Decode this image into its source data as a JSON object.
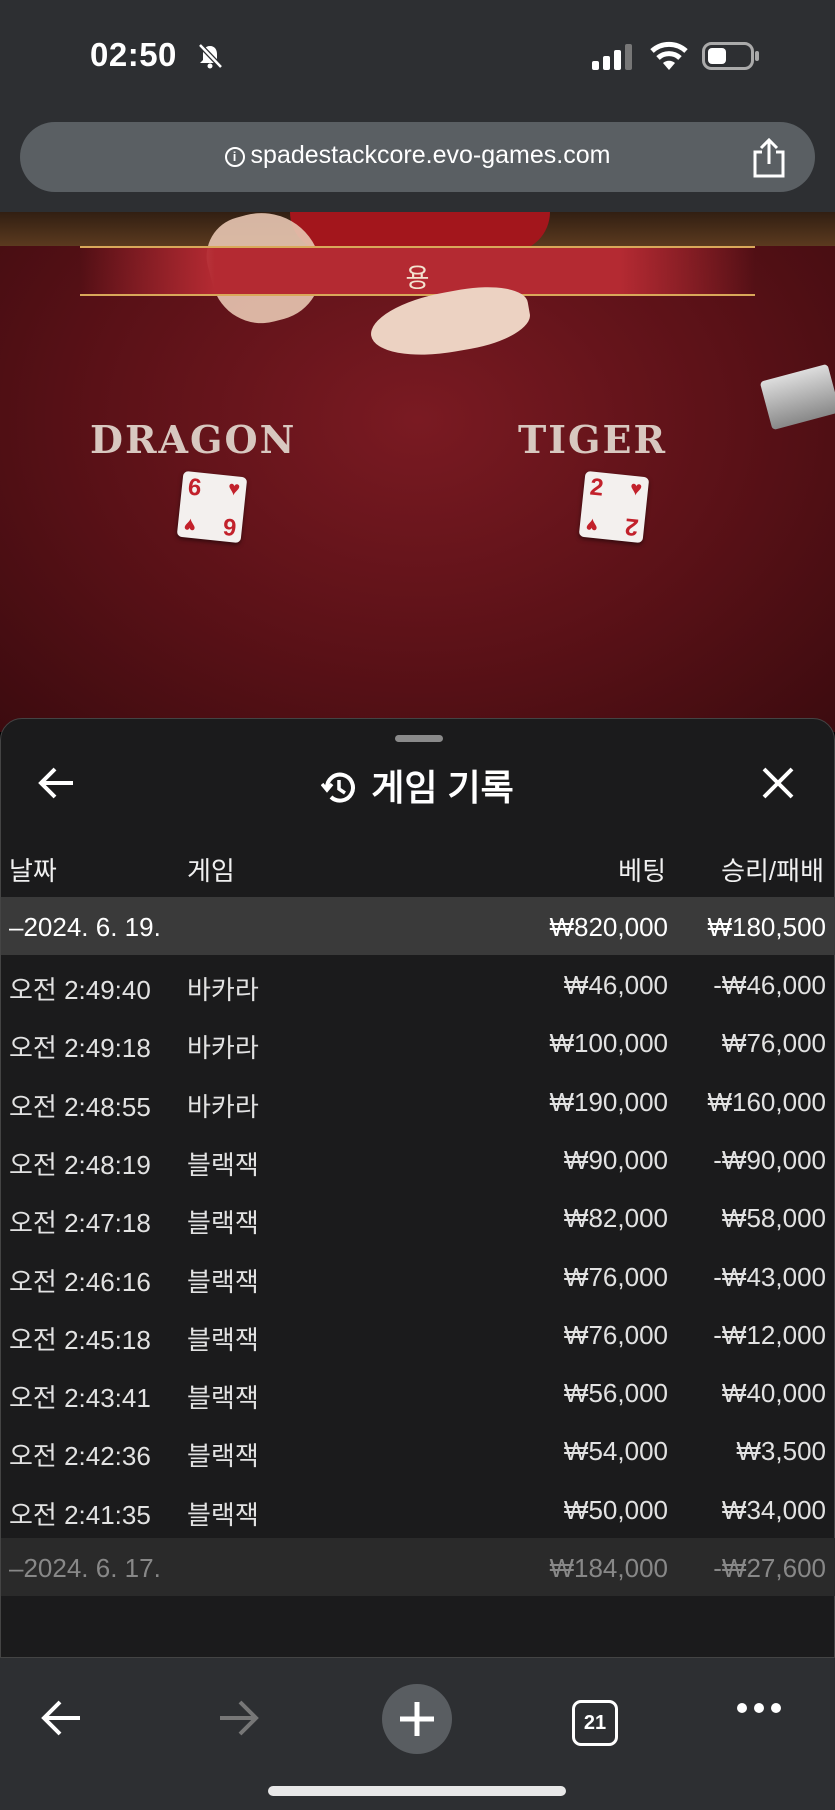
{
  "status": {
    "time": "02:50"
  },
  "browser": {
    "url": "spadestackcore.evo-games.com",
    "tab_count": "21"
  },
  "video": {
    "banner": "용",
    "left_label": "DRAGON",
    "right_label": "TIGER",
    "left_card": "6",
    "right_card": "2"
  },
  "panel": {
    "title": "게임 기록",
    "columns": {
      "date": "날짜",
      "game": "게임",
      "bet": "베팅",
      "winloss": "승리/패배"
    },
    "groups": [
      {
        "date": "–2024. 6. 19.",
        "bet": "₩820,000",
        "winloss": "₩180,500",
        "rows": [
          {
            "time": "오전 2:49:40",
            "game": "바카라",
            "bet": "₩46,000",
            "winloss": "-₩46,000"
          },
          {
            "time": "오전 2:49:18",
            "game": "바카라",
            "bet": "₩100,000",
            "winloss": "₩76,000"
          },
          {
            "time": "오전 2:48:55",
            "game": "바카라",
            "bet": "₩190,000",
            "winloss": "₩160,000"
          },
          {
            "time": "오전 2:48:19",
            "game": "블랙잭",
            "bet": "₩90,000",
            "winloss": "-₩90,000"
          },
          {
            "time": "오전 2:47:18",
            "game": "블랙잭",
            "bet": "₩82,000",
            "winloss": "₩58,000"
          },
          {
            "time": "오전 2:46:16",
            "game": "블랙잭",
            "bet": "₩76,000",
            "winloss": "-₩43,000"
          },
          {
            "time": "오전 2:45:18",
            "game": "블랙잭",
            "bet": "₩76,000",
            "winloss": "-₩12,000"
          },
          {
            "time": "오전 2:43:41",
            "game": "블랙잭",
            "bet": "₩56,000",
            "winloss": "₩40,000"
          },
          {
            "time": "오전 2:42:36",
            "game": "블랙잭",
            "bet": "₩54,000",
            "winloss": "₩3,500"
          },
          {
            "time": "오전 2:41:35",
            "game": "블랙잭",
            "bet": "₩50,000",
            "winloss": "₩34,000"
          }
        ]
      },
      {
        "date": "–2024. 6. 17.",
        "bet": "₩184,000",
        "winloss": "-₩27,600",
        "rows": []
      }
    ]
  }
}
